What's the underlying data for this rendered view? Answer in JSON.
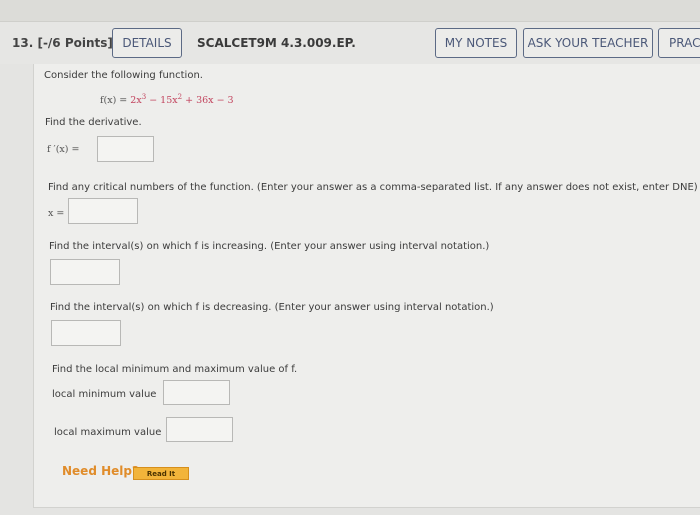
{
  "header": {
    "question_number": "13.",
    "points": "[-/6 Points]",
    "details_label": "DETAILS",
    "problem_code": "SCALCET9M 4.3.009.EP.",
    "my_notes_label": "MY NOTES",
    "ask_teacher_label": "ASK YOUR TEACHER",
    "practice_label": "PRAC"
  },
  "question": {
    "intro": "Consider the following function.",
    "function_lhs": "f(x) = ",
    "function_terms": {
      "t1": "2x",
      "t1_exp": "3",
      "op1": " − ",
      "t2": "15x",
      "t2_exp": "2",
      "op2": " + ",
      "t3": "36x",
      "op3": " − ",
      "t4": "3"
    },
    "derivative_prompt": "Find the derivative.",
    "derivative_label": "f ′(x) =",
    "derivative_value": "",
    "critical_prompt": "Find any critical numbers of the function. (Enter your answer as a comma-separated list. If any answer does not exist, enter DNE)",
    "critical_label": "x =",
    "critical_value": "",
    "increasing_prompt": "Find the interval(s) on which f is increasing. (Enter your answer using interval notation.)",
    "increasing_value": "",
    "decreasing_prompt": "Find the interval(s) on which f is decreasing. (Enter your answer using interval notation.)",
    "decreasing_value": "",
    "extrema_prompt": "Find the local minimum and maximum value of f.",
    "local_min_label": "local minimum value",
    "local_min_value": "",
    "local_max_label": "local maximum value",
    "local_max_value": ""
  },
  "help": {
    "need_help_label": "Need Help?",
    "read_it_label": "Read It"
  },
  "colors": {
    "button_border": "#5c6a85",
    "function_red": "#c2445e",
    "need_help_orange": "#e08c2a",
    "read_it_bg": "#f2b43a"
  }
}
